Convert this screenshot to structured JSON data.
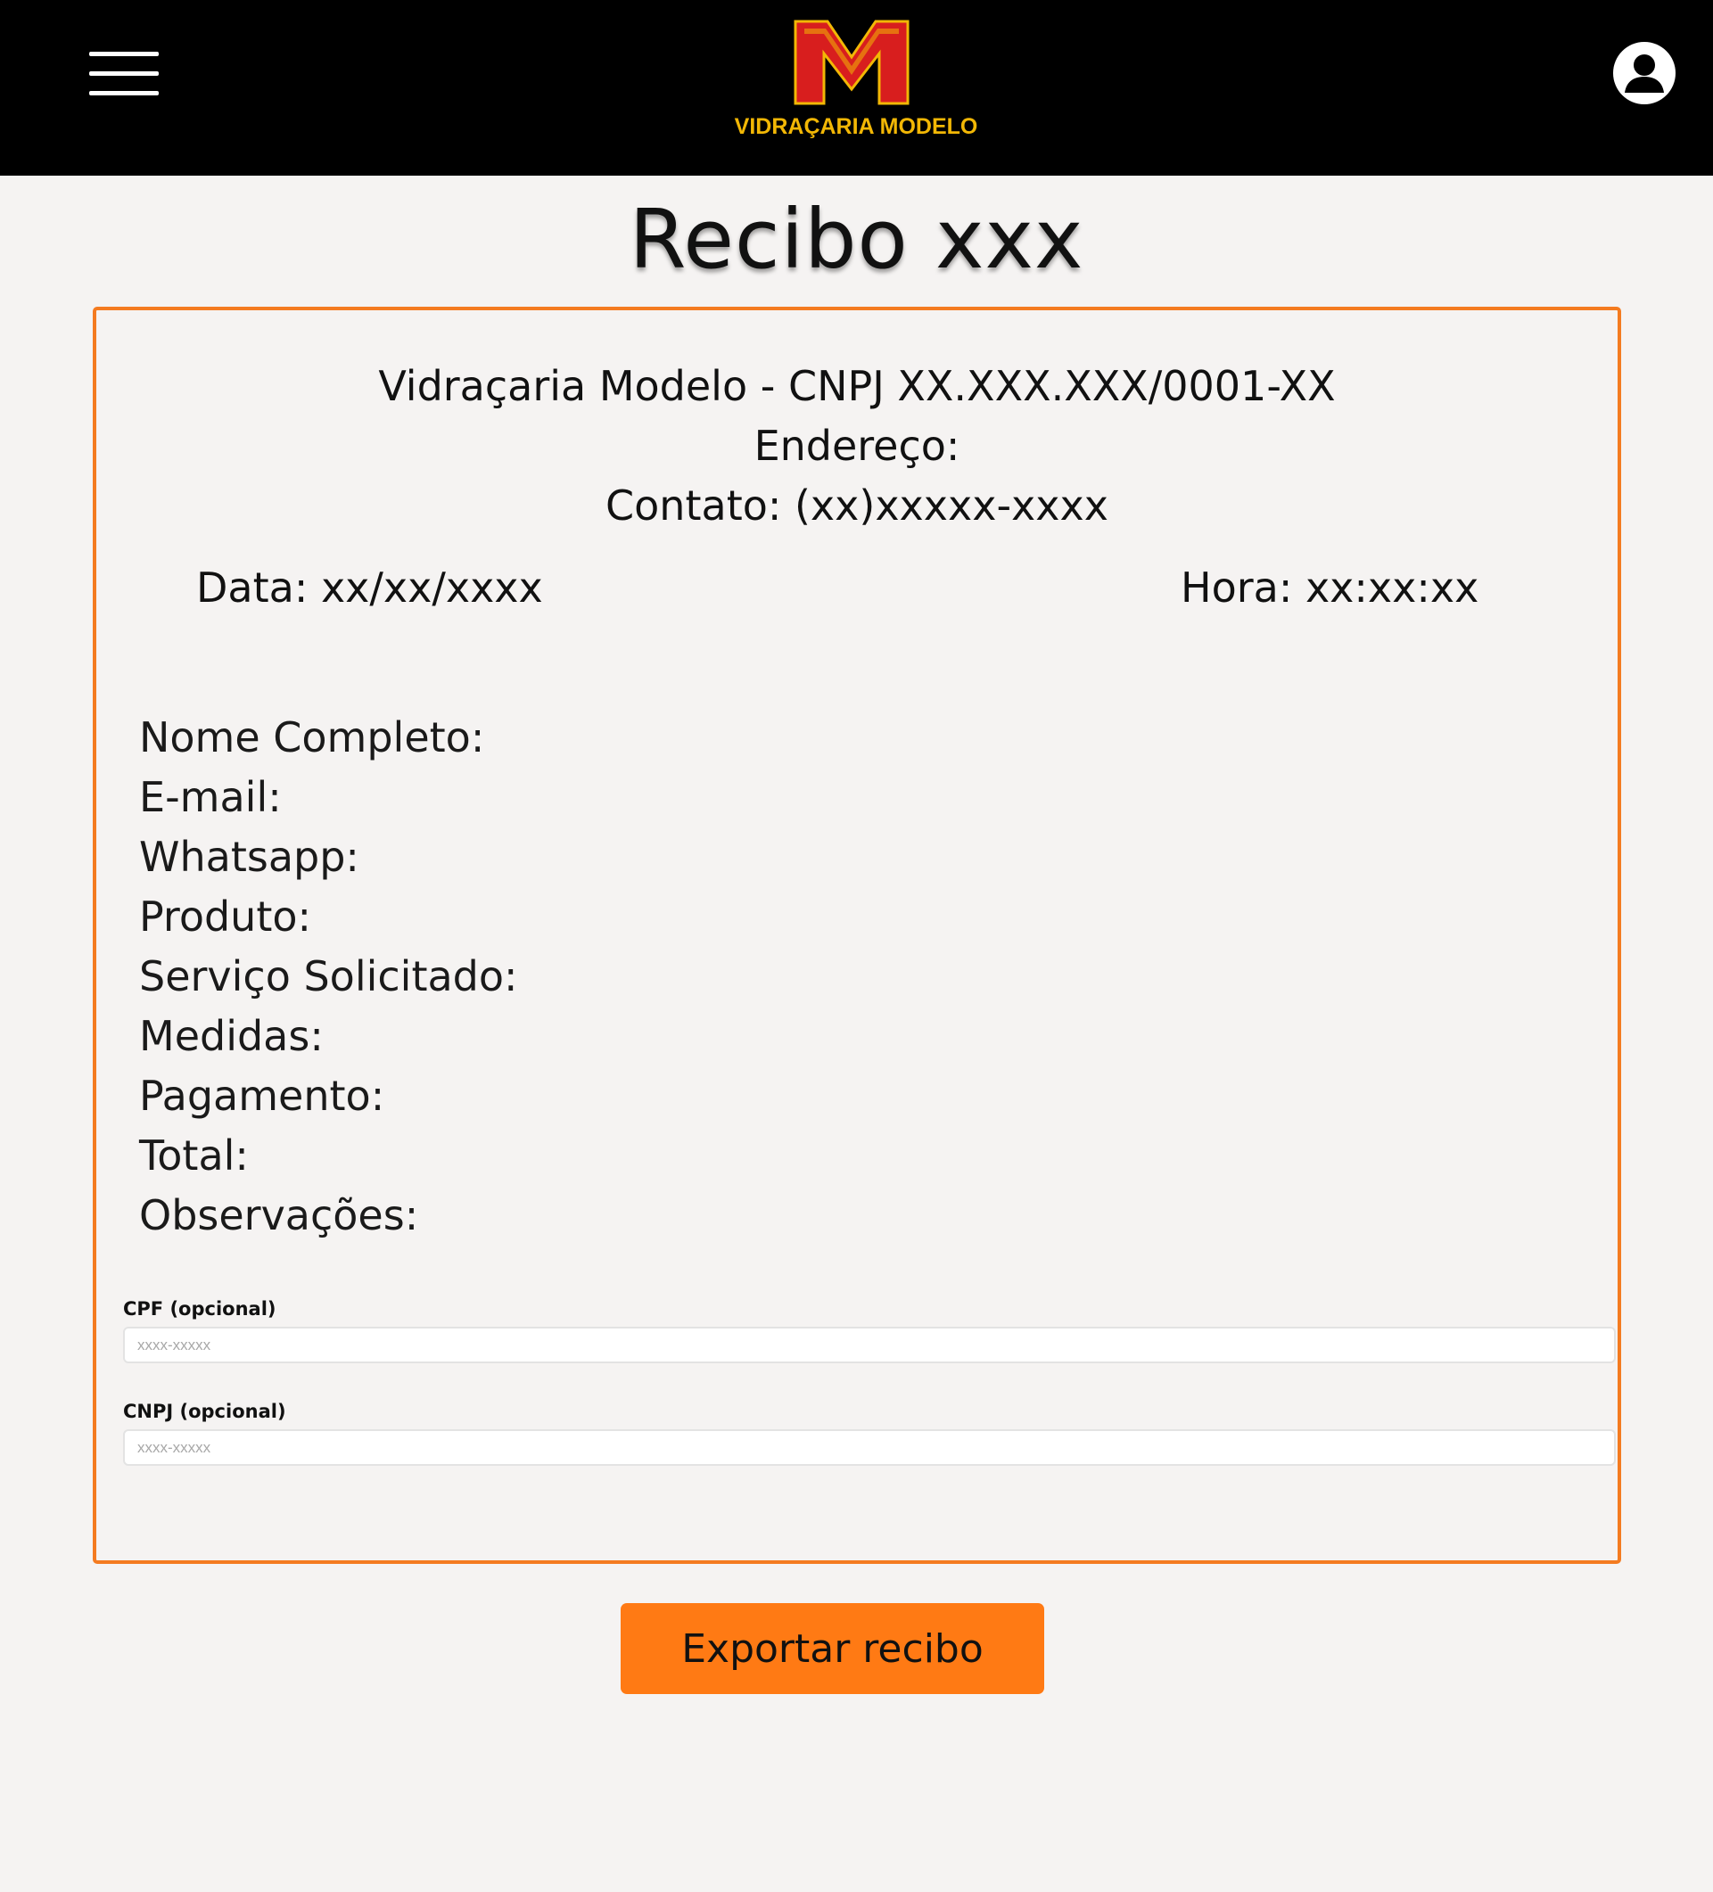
{
  "header": {
    "brand_name": "VIDRAÇARIA MODELO",
    "logo_letter": "M",
    "menu_icon": "hamburger-menu-icon",
    "user_icon": "user-account-icon",
    "colors": {
      "background": "#000000",
      "logo_red": "#d81e1e",
      "logo_gold": "#f2b705"
    }
  },
  "page": {
    "title": "Recibo xxx"
  },
  "receipt": {
    "company_line": "Vidraçaria Modelo - CNPJ XX.XXX.XXX/0001-XX",
    "address_line": "Endereço:",
    "contact_line": "Contato: (xx)xxxxx-xxxx",
    "date_line": "Data: xx/xx/xxxx",
    "time_line": "Hora: xx:xx:xx",
    "fields": [
      "Nome Completo:",
      "E-mail:",
      "Whatsapp:",
      "Produto:",
      "Serviço Solicitado:",
      "Medidas:",
      "Pagamento:",
      "Total:",
      "Observações:"
    ],
    "border_color": "#f47b20"
  },
  "optional_fields": {
    "cpf": {
      "label": "CPF (opcional)",
      "placeholder": "xxxx-xxxxx",
      "value": ""
    },
    "cnpj": {
      "label": "CNPJ (opcional)",
      "placeholder": "xxxx-xxxxx",
      "value": ""
    }
  },
  "actions": {
    "export_label": "Exportar recibo",
    "export_color": "#ff7a14"
  }
}
